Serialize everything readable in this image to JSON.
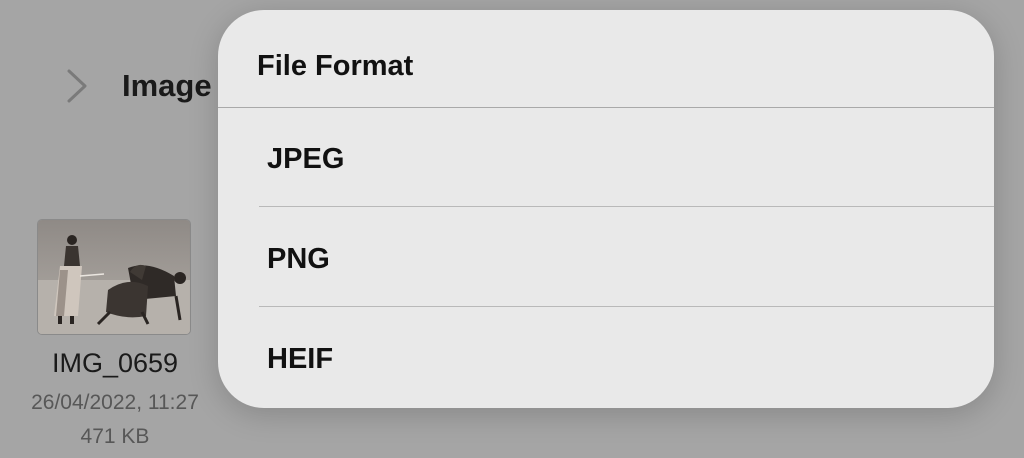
{
  "background": {
    "breadcrumb_title": "Image",
    "file": {
      "name": "IMG_0659",
      "date": "26/04/2022, 11:27",
      "size": "471 KB",
      "thumbnail_icon": "photo-thumbnail"
    }
  },
  "menu": {
    "title": "File Format",
    "options": [
      {
        "label": "JPEG"
      },
      {
        "label": "PNG"
      },
      {
        "label": "HEIF"
      }
    ]
  },
  "colors": {
    "dimmed_background": "#a5a5a5",
    "menu_background": "#e9e9e9",
    "separator": "#b9b9b9",
    "text_primary": "#111111",
    "text_secondary": "#575757"
  }
}
